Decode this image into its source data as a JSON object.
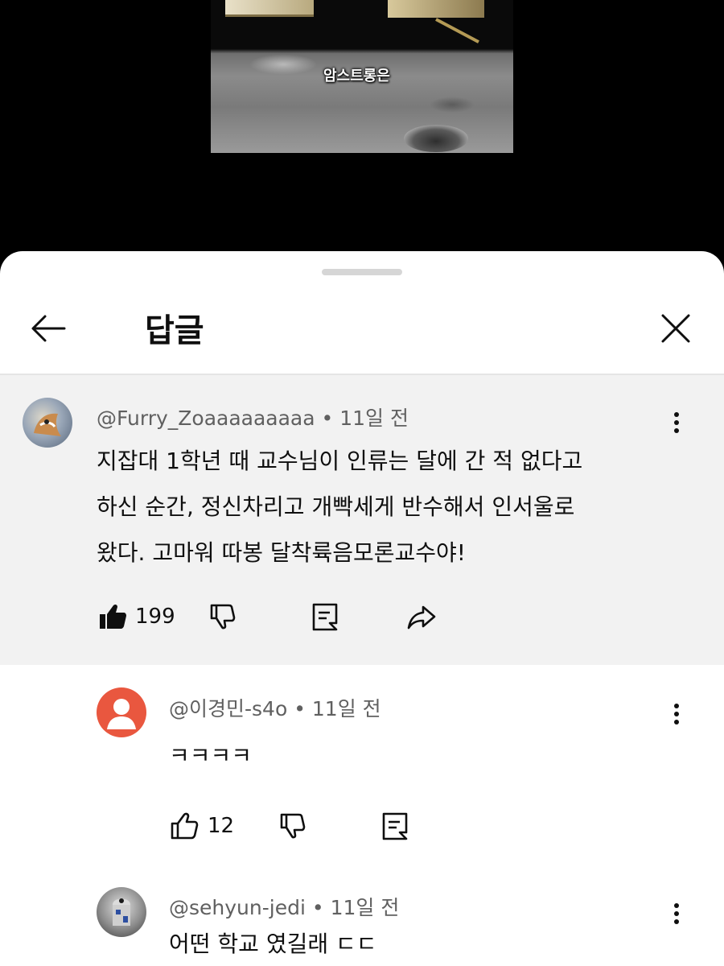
{
  "video": {
    "caption": "암스트롱은"
  },
  "header": {
    "title": "답글",
    "back_icon": "arrow-left-icon",
    "close_icon": "close-icon"
  },
  "comments": [
    {
      "author": "@Furry_Zoaaaaaaaaa",
      "time": "11일 전",
      "lines": [
        "지잡대 1학년 때 교수님이 인류는 달에 간 적 없다고",
        "하신 순간, 정신차리고 개빡세게 반수해서 인서울로",
        "왔다. 고마워 따봉 달착륙음모론교수야!"
      ],
      "likes": "199"
    },
    {
      "author": "@이경민-s4o",
      "time": "11일 전",
      "text": "ㅋㅋㅋㅋ",
      "likes": "12"
    },
    {
      "author": "@sehyun-jedi",
      "time": "11일 전",
      "text": "어떤 학교 였길래 ㄷㄷ"
    }
  ],
  "colors": {
    "accent_avatar": "#e9573f",
    "parent_bg": "#f2f2f2"
  }
}
